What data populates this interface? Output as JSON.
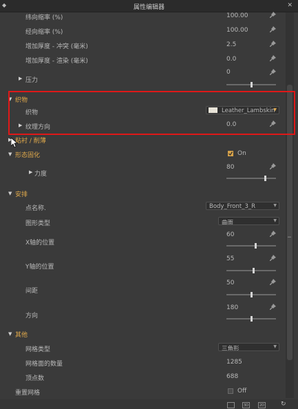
{
  "window": {
    "title": "属性编辑器"
  },
  "fabric": {
    "weft_shrink": {
      "label": "纬向缩率 (%)",
      "value": "100.00"
    },
    "warp_shrink": {
      "label": "经向缩率 (%)",
      "value": "100.00"
    },
    "thickness_collision": {
      "label": "增加厚度 - 冲突 (毫米)",
      "value": "2.5"
    },
    "thickness_render": {
      "label": "增加厚度 - 渲染 (毫米)",
      "value": "0.0"
    },
    "pressure": {
      "label": "压力",
      "value": "0",
      "slider": 0.5
    }
  },
  "material": {
    "section": "织物",
    "fabric_label": "织物",
    "fabric_value": "Leather_Lambskin",
    "grain_label": "纹理方向",
    "grain_value": "0.0"
  },
  "bond": {
    "section": "粘衬 / 削薄"
  },
  "solidify": {
    "section": "形态固化",
    "checkbox_label": "On",
    "checked": true,
    "strength_label": "力度",
    "strength_value": "80",
    "strength_slider": 0.8
  },
  "arrangement": {
    "section": "安排",
    "point_label": "点名称.",
    "point_value": "Body_Front_3_R",
    "shape_label": "图形类型",
    "shape_value": "曲面",
    "x_label": "X轴的位置",
    "x_value": "60",
    "x_slider": 0.6,
    "y_label": "Y轴的位置",
    "y_value": "55",
    "y_slider": 0.55,
    "gap_label": "间距",
    "gap_value": "50",
    "gap_slider": 0.5,
    "dir_label": "方向",
    "dir_value": "180",
    "dir_slider": 0.5
  },
  "other": {
    "section": "其他",
    "mesh_type_label": "网格类型",
    "mesh_type_value": "三角形",
    "mesh_count_label": "网格面的数量",
    "mesh_count_value": "1285",
    "vertex_label": "顶点数",
    "vertex_value": "688",
    "reset_label": "重置网格",
    "reset_checkbox_label": "Off",
    "reset_checked": false
  },
  "colors": {
    "accent": "#e0a94b",
    "highlight": "#e01818",
    "background": "#3a3a3a"
  },
  "icons": [
    "pin-icon",
    "close-icon",
    "pushpin-icon",
    "dropdown-arrow-icon",
    "expand-caret-icon",
    "collapse-caret-icon",
    "checkbox-icon",
    "mouse-cursor-icon"
  ]
}
